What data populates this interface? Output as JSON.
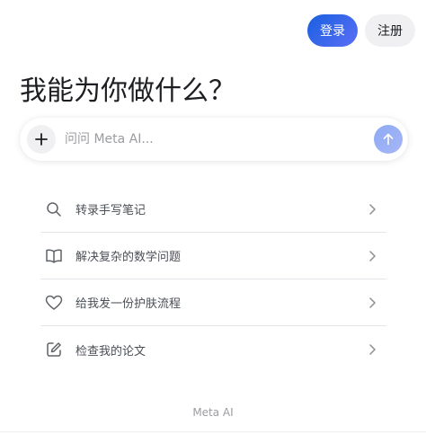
{
  "header": {
    "login_label": "登录",
    "signup_label": "注册"
  },
  "headline": "我能为你做什么？",
  "composer": {
    "placeholder": "问问 Meta AI...",
    "value": ""
  },
  "suggestions": [
    {
      "label": "转录手写笔记",
      "icon": "search-icon"
    },
    {
      "label": "解决复杂的数学问题",
      "icon": "book-icon"
    },
    {
      "label": "给我发一份护肤流程",
      "icon": "heart-icon"
    },
    {
      "label": "检查我的论文",
      "icon": "edit-icon"
    }
  ],
  "footer": {
    "text": "Meta AI"
  },
  "colors": {
    "accent": "#1a5fe0",
    "send_button": "#8eaaf3"
  }
}
